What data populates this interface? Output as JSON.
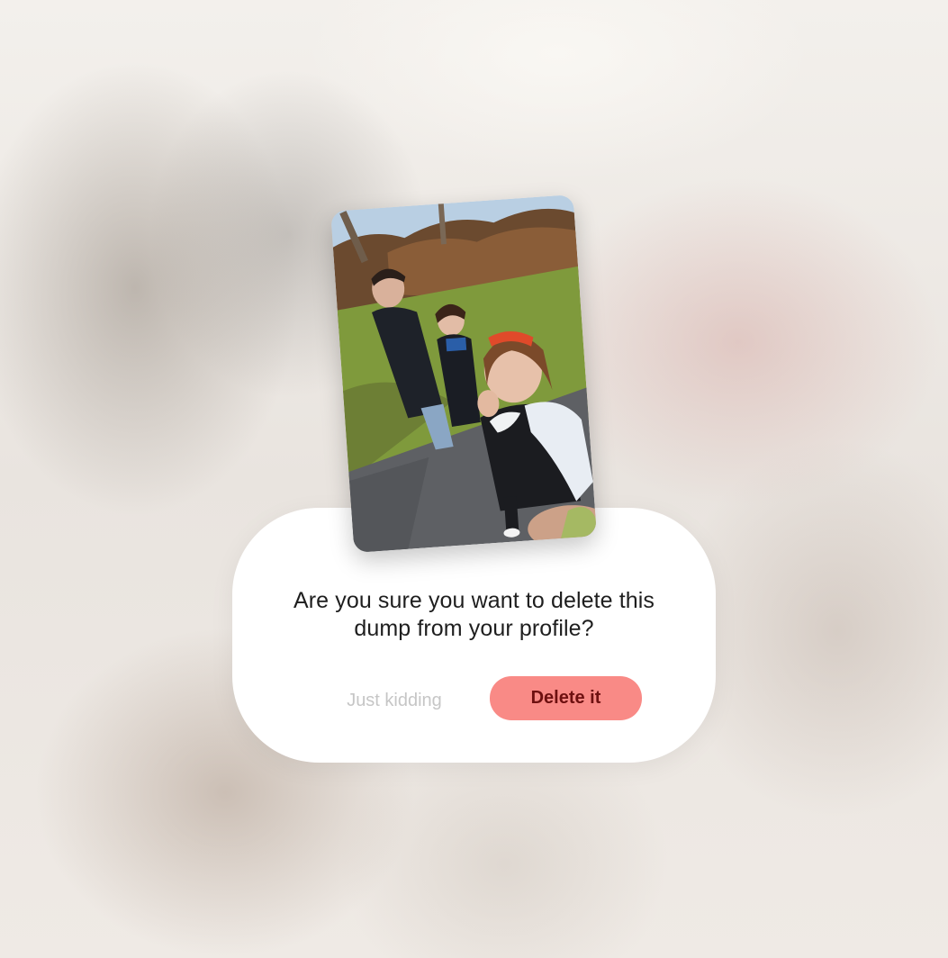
{
  "dialog": {
    "message": "Are you sure you want to delete this dump from your profile?",
    "cancel_label": "Just kidding",
    "confirm_label": "Delete it"
  },
  "photo": {
    "subject": "photo-of-three-friends-outdoors"
  },
  "colors": {
    "confirm_button_bg": "#f98a86",
    "confirm_button_text": "#6e1010",
    "cancel_text": "#c6c6c6",
    "dialog_bg": "#ffffff"
  }
}
